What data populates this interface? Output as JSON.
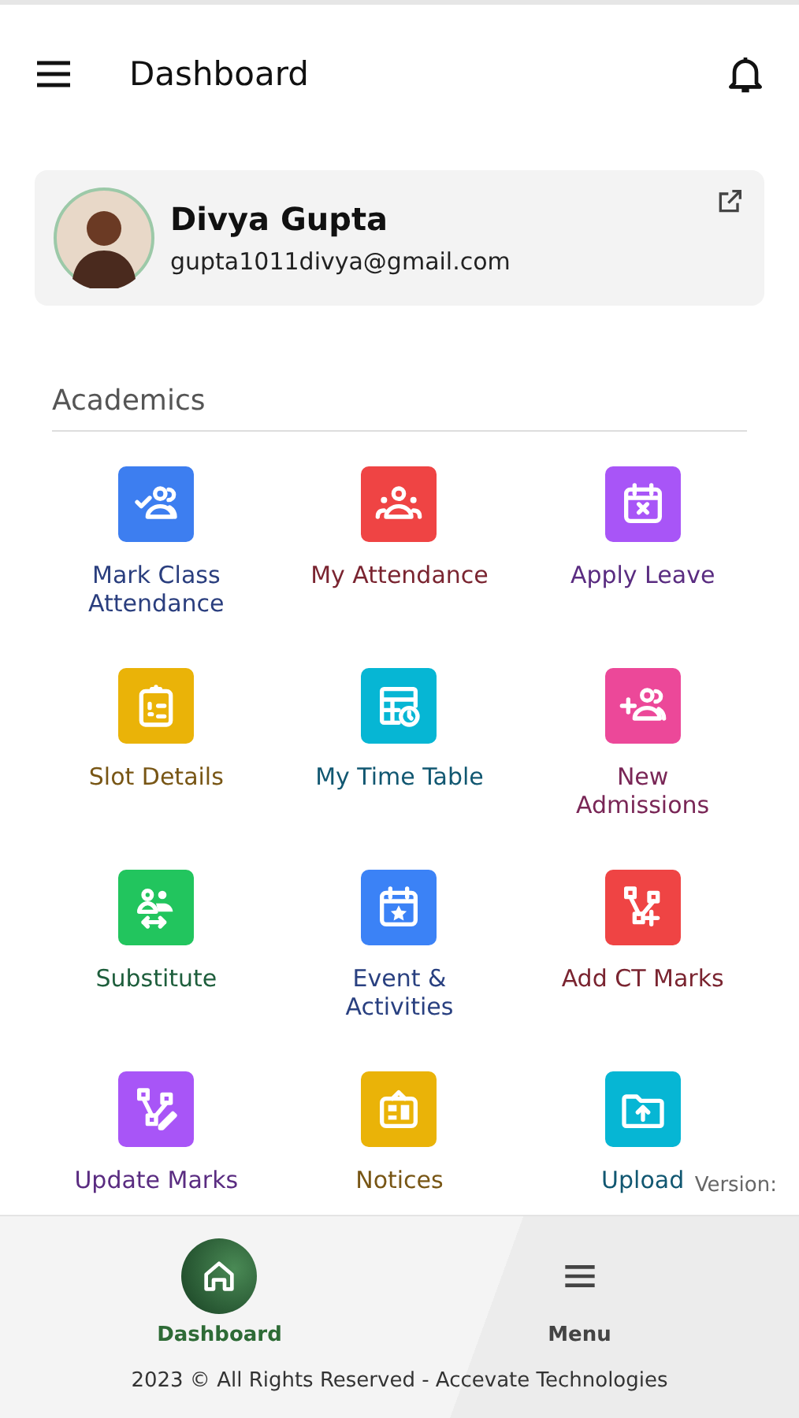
{
  "header": {
    "title": "Dashboard"
  },
  "profile": {
    "name": "Divya Gupta",
    "email": "gupta1011divya@gmail.com"
  },
  "section": {
    "title": "Academics"
  },
  "tiles": [
    {
      "label": "Mark Class Attendance",
      "color": "#3d7ef0"
    },
    {
      "label": "My Attendance",
      "color": "#ef4444"
    },
    {
      "label": "Apply Leave",
      "color": "#a855f7"
    },
    {
      "label": "Slot Details",
      "color": "#eab308"
    },
    {
      "label": "My Time Table",
      "color": "#06b6d4"
    },
    {
      "label": "New Admissions",
      "color": "#ec4899"
    },
    {
      "label": "Substitute",
      "color": "#22c55e"
    },
    {
      "label": "Event & Activities",
      "color": "#3b82f6"
    },
    {
      "label": "Add CT Marks",
      "color": "#ef4444"
    },
    {
      "label": "Update Marks",
      "color": "#a855f7"
    },
    {
      "label": "Notices",
      "color": "#eab308"
    },
    {
      "label": "Upload",
      "color": "#06b6d4"
    }
  ],
  "version_label": "Version:",
  "bottom_nav": [
    {
      "label": "Dashboard",
      "selected": true
    },
    {
      "label": "Menu",
      "selected": false
    }
  ],
  "footer": "2023 © All Rights Reserved - Accevate Technologies"
}
